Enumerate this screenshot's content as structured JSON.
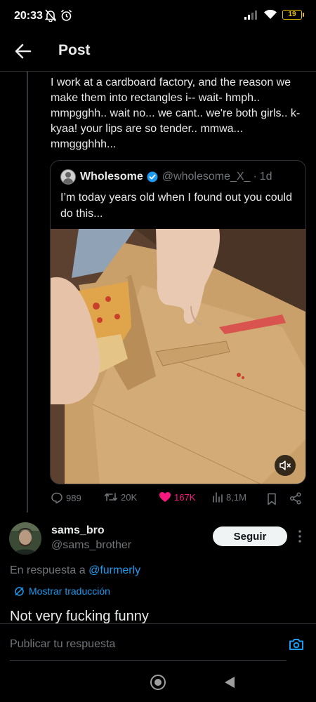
{
  "status_bar": {
    "time": "20:33",
    "battery": "19"
  },
  "header": {
    "title": "Post"
  },
  "post": {
    "text": "I work at a cardboard factory, and the reason we make them into rectangles i-- wait- hmph.. mmpgghh.. wait no... we cant.. we're both girls.. k-kyaa! your lips are so tender.. mmwa... mmggghhh..."
  },
  "quote": {
    "name": "Wholesome",
    "handle": "@wholesome_X_",
    "separator": "·",
    "time": "1d",
    "text": "I’m today years old when I found out you could do this..."
  },
  "actions": {
    "replies": "989",
    "reposts": "20K",
    "likes": "167K",
    "views": "8,1M"
  },
  "reply": {
    "name": "sams_bro",
    "handle": "@sams_brother",
    "follow_label": "Seguir",
    "reply_to_prefix": "En respuesta a",
    "reply_to_mention": "@furmerly",
    "translate_label": "Mostrar traducción",
    "text": "Not very fucking funny"
  },
  "compose": {
    "placeholder": "Publicar tu respuesta"
  },
  "colors": {
    "accent": "#1d9bf0",
    "like": "#f91880",
    "muted": "#71767b",
    "background": "#000000"
  }
}
